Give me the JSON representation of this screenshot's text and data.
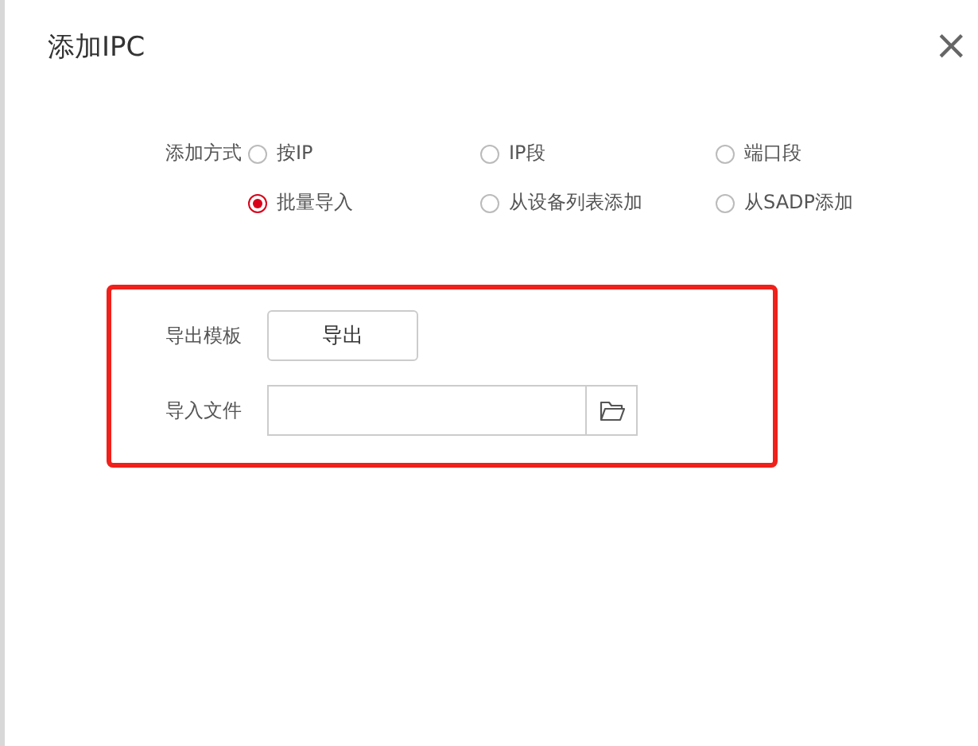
{
  "dialog": {
    "title": "添加IPC",
    "close": "×"
  },
  "add_mode": {
    "label": "添加方式",
    "options": [
      {
        "label": "按IP",
        "selected": false
      },
      {
        "label": "IP段",
        "selected": false
      },
      {
        "label": "端口段",
        "selected": false
      },
      {
        "label": "批量导入",
        "selected": true
      },
      {
        "label": "从设备列表添加",
        "selected": false
      },
      {
        "label": "从SADP添加",
        "selected": false
      }
    ]
  },
  "batch_import": {
    "highlighted": true,
    "export_label": "导出模板",
    "export_button": "导出",
    "import_label": "导入文件"
  }
}
